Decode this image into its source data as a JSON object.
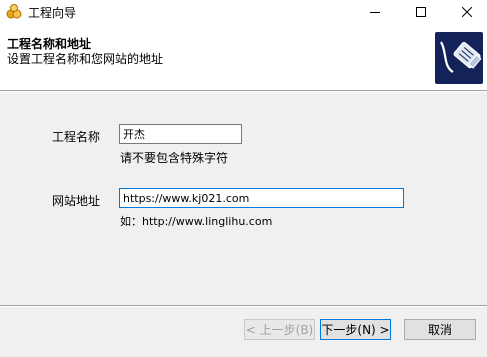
{
  "window": {
    "title": "工程向导",
    "controls": {
      "minimize": "—",
      "maximize": "☐",
      "close": "✕"
    }
  },
  "header": {
    "title": "工程名称和地址",
    "subtitle": "设置工程名称和您网站的地址",
    "icon": "network-cable-plug-icon"
  },
  "form": {
    "project_name": {
      "label": "工程名称",
      "value": "开杰",
      "hint": "请不要包含特殊字符"
    },
    "site_url": {
      "label": "网站地址",
      "value": "https://www.kj021.com",
      "hint": "如：http://www.linglihu.com"
    }
  },
  "buttons": {
    "back": "< 上一步(B)",
    "next": "下一步(N) >",
    "cancel": "取消"
  },
  "colors": {
    "header_icon_bg": "#13235a",
    "focus_border": "#0078d7",
    "app_icon": "#e8a317"
  }
}
